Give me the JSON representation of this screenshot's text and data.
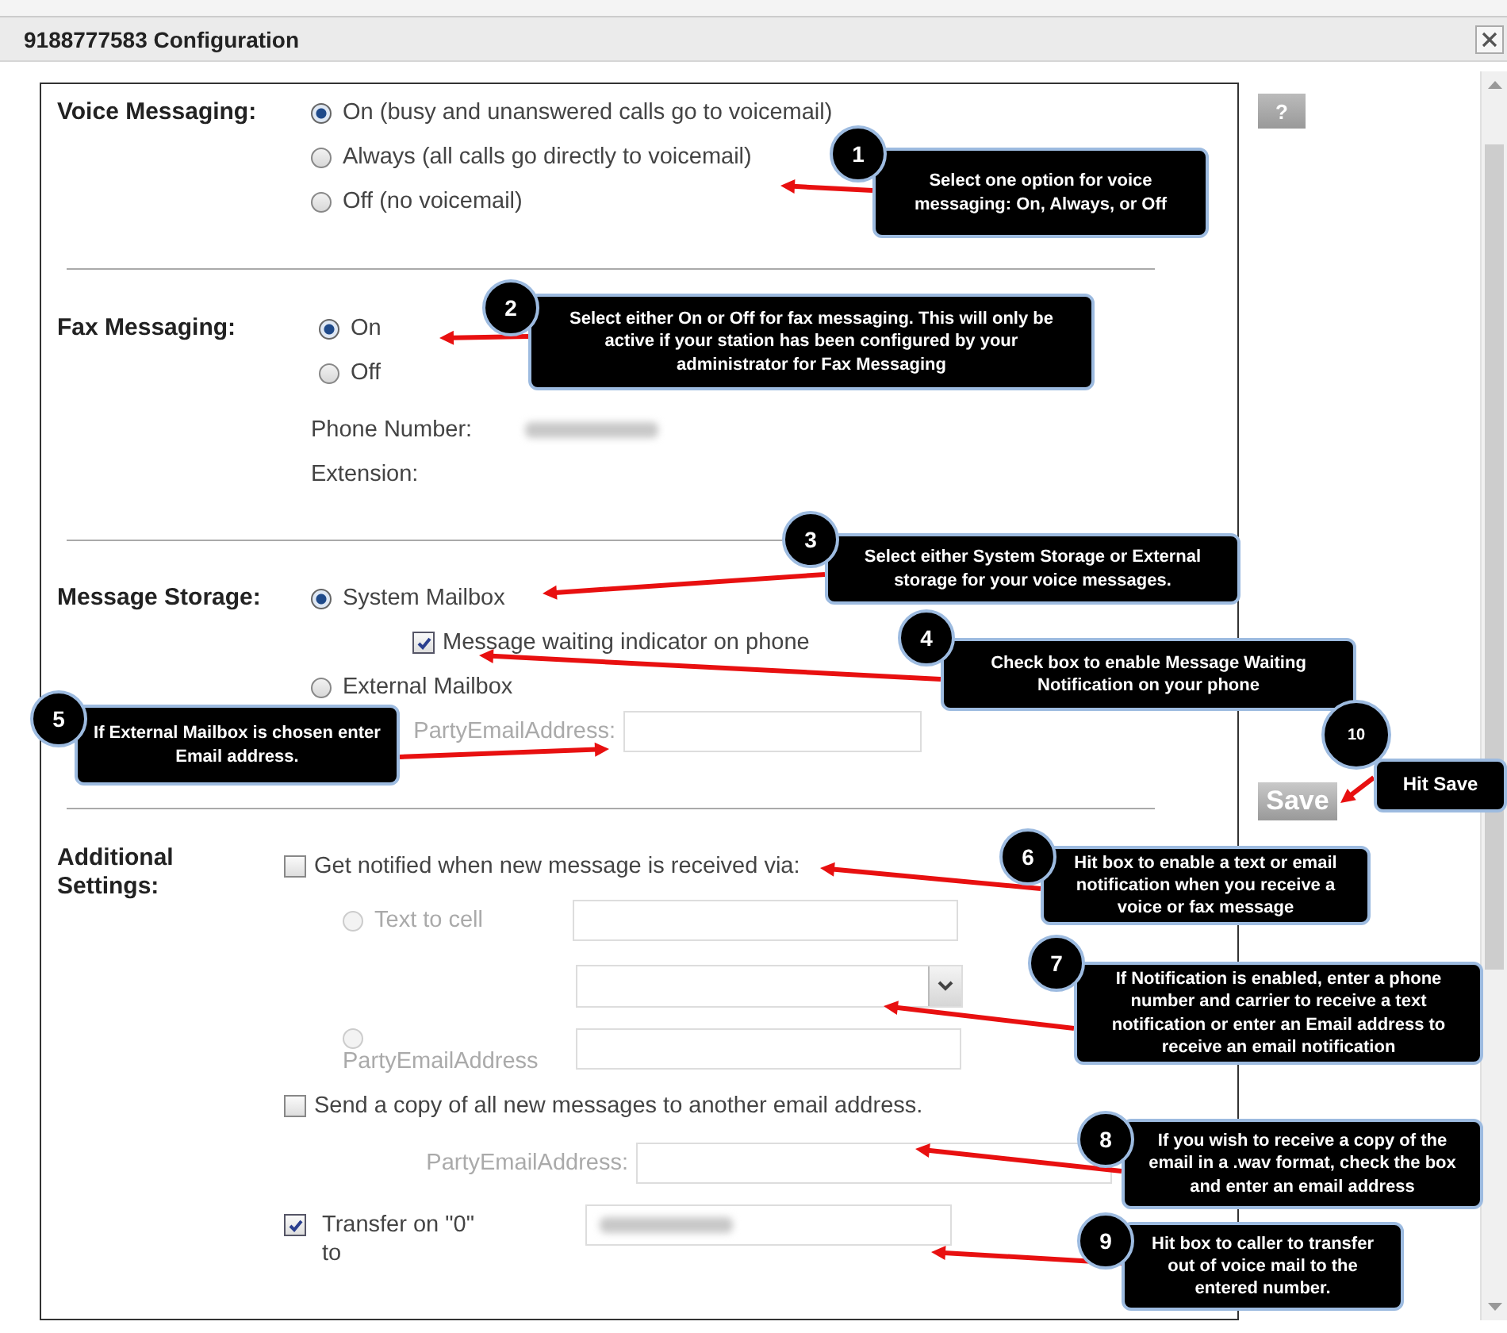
{
  "dialog": {
    "title": "9188777583 Configuration"
  },
  "help_button": "?",
  "voice_messaging": {
    "label": "Voice Messaging:",
    "options": [
      {
        "label": "On (busy and unanswered calls go to voicemail)",
        "selected": true
      },
      {
        "label": "Always (all calls go directly to voicemail)",
        "selected": false
      },
      {
        "label": "Off (no voicemail)",
        "selected": false
      }
    ]
  },
  "fax_messaging": {
    "label": "Fax Messaging:",
    "options": [
      {
        "label": "On",
        "selected": true
      },
      {
        "label": "Off",
        "selected": false
      }
    ],
    "phone_number_label": "Phone Number:",
    "extension_label": "Extension:"
  },
  "message_storage": {
    "label": "Message Storage:",
    "options": [
      {
        "label": "System Mailbox",
        "selected": true
      },
      {
        "label": "External Mailbox",
        "selected": false
      }
    ],
    "indicator": {
      "label": "Message waiting indicator on phone",
      "checked": true
    },
    "email_label": "PartyEmailAddress:"
  },
  "additional_settings": {
    "label": "Additional Settings:",
    "notify": {
      "label": "Get notified when new message is received via:",
      "checked": false
    },
    "notify_options": [
      {
        "label": "Text to cell",
        "selected": false,
        "disabled": true
      },
      {
        "label": "PartyEmailAddress",
        "selected": false,
        "disabled": true
      }
    ],
    "copy": {
      "label": "Send a copy of all new messages to another email address.",
      "checked": false
    },
    "copy_email_label": "PartyEmailAddress:",
    "transfer": {
      "label": "Transfer on \"0\" to",
      "checked": true
    }
  },
  "save_button": "Save",
  "annotations": [
    {
      "number": "1",
      "text": "Select one option for voice messaging: On, Always, or Off"
    },
    {
      "number": "2",
      "text": "Select either On or Off for fax messaging. This will only be active if your station has been configured by your administrator for Fax Messaging"
    },
    {
      "number": "3",
      "text": "Select either System Storage or External storage for your voice messages."
    },
    {
      "number": "4",
      "text": "Check box to enable Message Waiting Notification on your phone"
    },
    {
      "number": "5",
      "text": "If External Mailbox is chosen enter Email address."
    },
    {
      "number": "6",
      "text": "Hit box to enable a text or email notification when you receive a voice or fax message"
    },
    {
      "number": "7",
      "text": "If Notification is enabled, enter a phone number and carrier to receive a text notification or enter an Email address to receive an email notification"
    },
    {
      "number": "8",
      "text": "If you wish to receive a copy of the email in a .wav format, check the box and enter an email address"
    },
    {
      "number": "9",
      "text": "Hit box to caller to transfer out of voice mail to the entered number."
    },
    {
      "number": "10",
      "text": "Hit Save"
    }
  ]
}
